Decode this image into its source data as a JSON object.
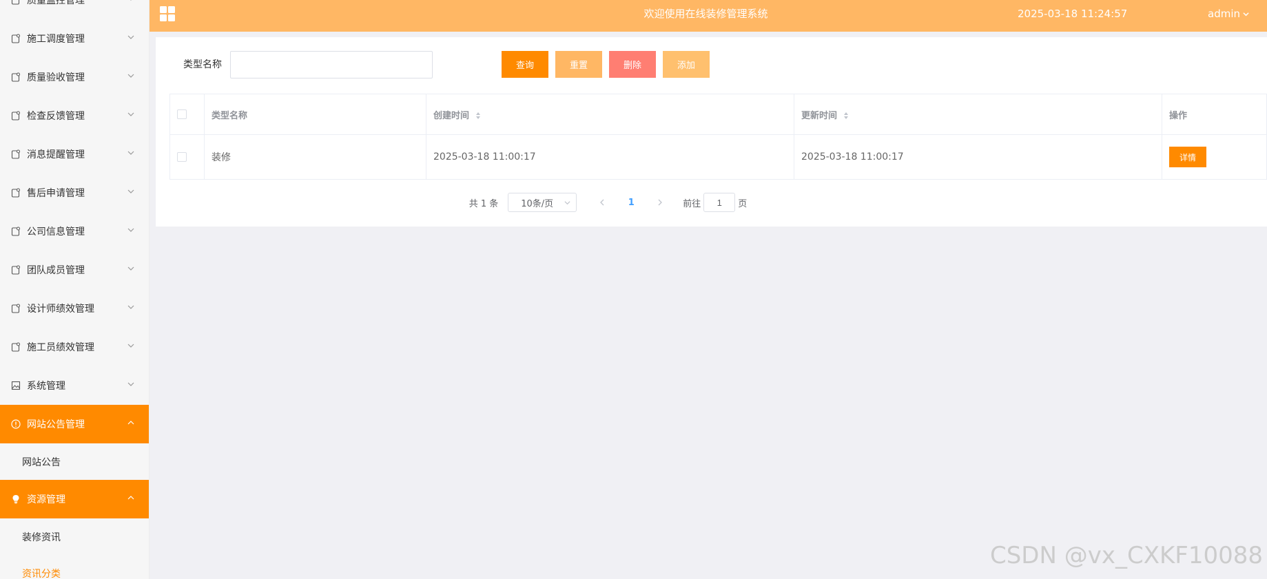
{
  "header": {
    "title": "欢迎使用在线装修管理系统",
    "clock": "2025-03-18 11:24:57",
    "user": "admin"
  },
  "sidebar": {
    "items": [
      {
        "label": "质量监控管理",
        "icon": "page-icon"
      },
      {
        "label": "施工调度管理",
        "icon": "page-icon"
      },
      {
        "label": "质量验收管理",
        "icon": "page-icon"
      },
      {
        "label": "检查反馈管理",
        "icon": "page-icon"
      },
      {
        "label": "消息提醒管理",
        "icon": "page-icon"
      },
      {
        "label": "售后申请管理",
        "icon": "page-icon"
      },
      {
        "label": "公司信息管理",
        "icon": "page-icon"
      },
      {
        "label": "团队成员管理",
        "icon": "page-icon"
      },
      {
        "label": "设计师绩效管理",
        "icon": "page-icon"
      },
      {
        "label": "施工员绩效管理",
        "icon": "page-icon"
      },
      {
        "label": "系统管理",
        "icon": "image-icon"
      },
      {
        "label": "网站公告管理",
        "icon": "info-circle-icon"
      },
      {
        "label": "网站公告"
      },
      {
        "label": "资源管理",
        "icon": "bulb-icon"
      },
      {
        "label": "装修资讯"
      },
      {
        "label": "资讯分类"
      }
    ]
  },
  "search": {
    "label": "类型名称",
    "value": "",
    "placeholder": ""
  },
  "buttons": {
    "query": "查询",
    "reset": "重置",
    "delete": "删除",
    "add": "添加"
  },
  "table": {
    "headers": [
      "类型名称",
      "创建时间",
      "更新时间",
      "操作"
    ],
    "rows": [
      {
        "name": "装修",
        "created": "2025-03-18 11:00:17",
        "updated": "2025-03-18 11:00:17",
        "action": "详情"
      }
    ]
  },
  "pager": {
    "total": "共 1 条",
    "size": "10条/页",
    "current": "1",
    "goto_prefix": "前往",
    "goto_value": "1",
    "goto_suffix": "页"
  },
  "watermark": "CSDN @vx_CXKF10088",
  "colors": {
    "header": "#ffb764",
    "primary": "#ff8a00",
    "reset": "#ffb764",
    "delete": "#ff7e72",
    "add": "#ffc06e"
  }
}
